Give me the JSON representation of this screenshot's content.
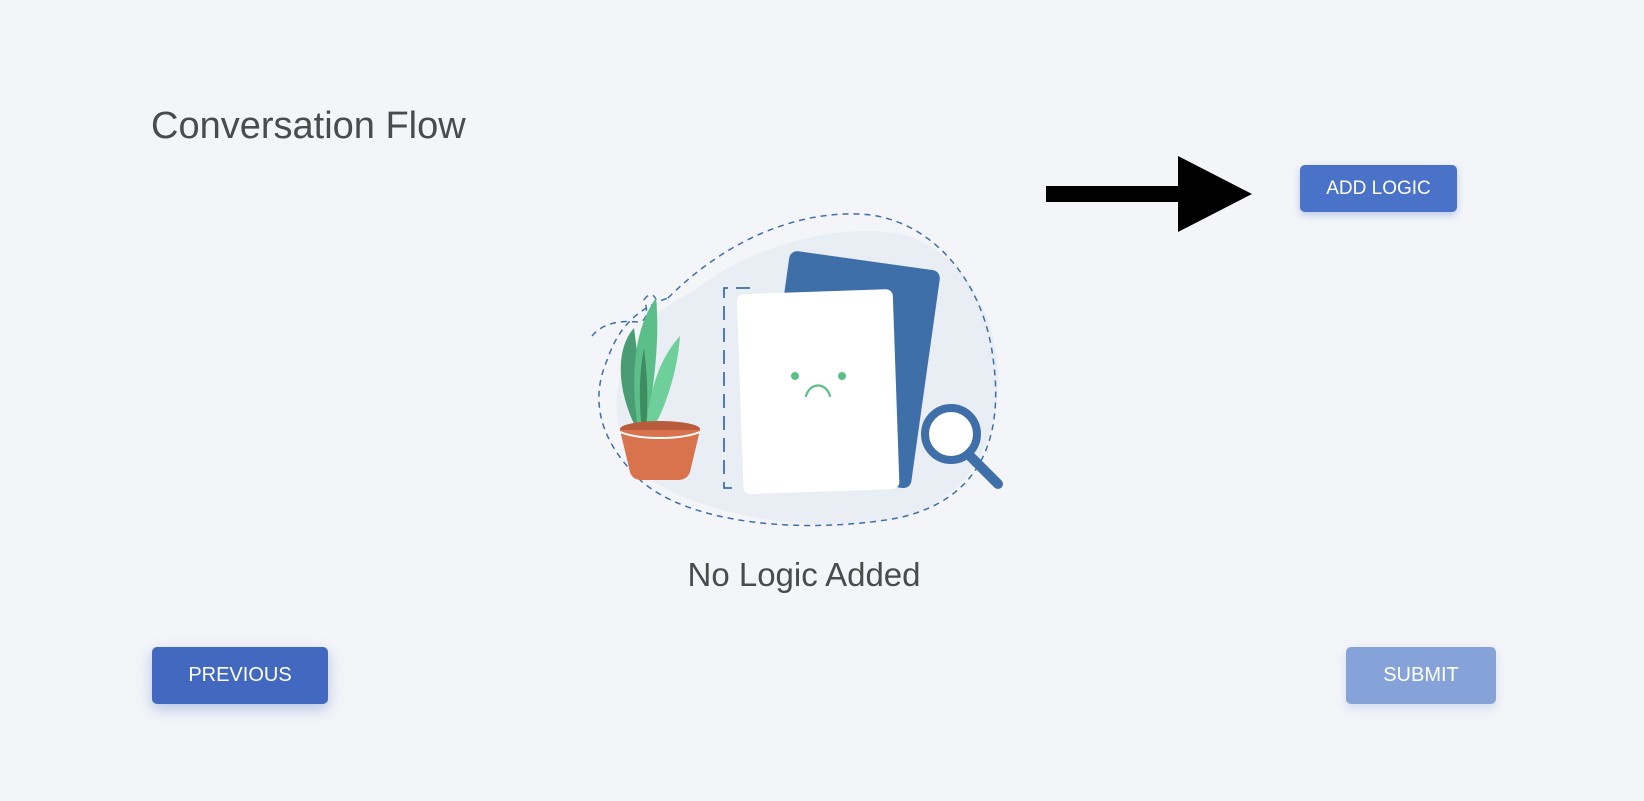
{
  "header": {
    "title": "Conversation Flow"
  },
  "actions": {
    "add_logic_label": "ADD LOGIC"
  },
  "empty_state": {
    "message": "No Logic Added",
    "illustration_icon": "empty-document-search-illustration"
  },
  "annotation": {
    "icon": "arrow-right-icon",
    "color": "#000000"
  },
  "footer": {
    "previous_label": "PREVIOUS",
    "submit_label": "SUBMIT"
  },
  "colors": {
    "background": "#f3f5f9",
    "primary": "#4a72c9",
    "primary_disabled": "#86a3d9",
    "text": "#4b4b4b",
    "document_blue": "#3f6fa8",
    "plant_green": "#5cbf8a",
    "pot_orange": "#d9734e"
  }
}
